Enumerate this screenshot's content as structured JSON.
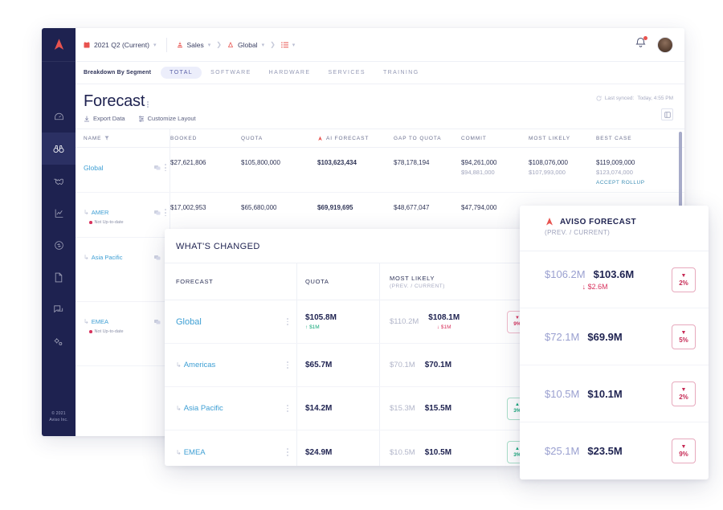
{
  "app": {
    "logo_alt": "aviso-logo",
    "copyright_line1": "© 2021",
    "copyright_line2": "Aviso Inc."
  },
  "sidebar": {
    "items": [
      {
        "name": "dashboard",
        "icon": "gauge-icon"
      },
      {
        "name": "forecast",
        "icon": "binoculars-icon",
        "active": true
      },
      {
        "name": "deals",
        "icon": "handshake-icon"
      },
      {
        "name": "analytics",
        "icon": "chart-icon"
      },
      {
        "name": "activity",
        "icon": "sync-icon"
      },
      {
        "name": "reports",
        "icon": "document-icon"
      },
      {
        "name": "conversations",
        "icon": "chat-icon"
      },
      {
        "name": "settings",
        "icon": "gears-icon"
      }
    ]
  },
  "topbar": {
    "period": "2021 Q2 (Current)",
    "team": "Sales",
    "scope": "Global",
    "notification_badge": true
  },
  "segment_bar": {
    "label": "Breakdown By Segment",
    "tabs": [
      {
        "label": "TOTAL",
        "active": true
      },
      {
        "label": "SOFTWARE",
        "active": false
      },
      {
        "label": "HARDWARE",
        "active": false
      },
      {
        "label": "SERVICES",
        "active": false
      },
      {
        "label": "TRAINING",
        "active": false
      }
    ]
  },
  "page": {
    "title": "Forecast",
    "actions": [
      {
        "label": "Export Data",
        "icon": "download-icon"
      },
      {
        "label": "Customize Layout",
        "icon": "sliders-icon"
      }
    ],
    "sync_label": "Last synced:",
    "sync_value": "Today, 4:55 PM"
  },
  "table": {
    "columns": [
      "NAME",
      "BOOKED",
      "QUOTA",
      "AI FORECAST",
      "GAP TO QUOTA",
      "COMMIT",
      "MOST LIKELY",
      "BEST CASE"
    ],
    "rows": [
      {
        "name": "Global",
        "indent": false,
        "stale": null,
        "booked": "$27,621,806",
        "quota": "$105,800,000",
        "ai_forecast": "$103,623,434",
        "gap_to_quota": "$78,178,194",
        "commit": "$94,261,000",
        "commit_prev": "$94,881,000",
        "most_likely": "$108,076,000",
        "most_likely_prev": "$107,993,000",
        "best_case": "$119,009,000",
        "best_case_prev": "$123,074,000",
        "accept_rollup": "ACCEPT ROLLUP"
      },
      {
        "name": "AMER",
        "indent": true,
        "stale": "Not Up-to-date",
        "booked": "$17,002,953",
        "quota": "$65,680,000",
        "ai_forecast": "$69,919,695",
        "gap_to_quota": "$48,677,047",
        "commit": "$47,794,000",
        "commit_prev": "",
        "most_likely": "",
        "most_likely_prev": "",
        "best_case": "",
        "best_case_prev": "",
        "accept_rollup": ""
      },
      {
        "name": "Asia Pacific",
        "indent": true,
        "stale": null,
        "booked": "",
        "quota": "",
        "ai_forecast": "",
        "gap_to_quota": "",
        "commit": "",
        "commit_prev": "",
        "most_likely": "",
        "most_likely_prev": "",
        "best_case": "",
        "best_case_prev": "",
        "accept_rollup": ""
      },
      {
        "name": "EMEA",
        "indent": true,
        "stale": "Not Up-to-date",
        "booked": "",
        "quota": "",
        "ai_forecast": "",
        "gap_to_quota": "",
        "commit": "",
        "commit_prev": "",
        "most_likely": "",
        "most_likely_prev": "",
        "best_case": "",
        "best_case_prev": "",
        "accept_rollup": ""
      }
    ]
  },
  "whats_changed": {
    "title": "WHAT'S CHANGED",
    "col_forecast": "FORECAST",
    "col_quota": "QUOTA",
    "col_most_likely": "MOST LIKELY",
    "col_most_likely_sub": "(PREV. / CURRENT)",
    "rows": [
      {
        "name": "Global",
        "indent": false,
        "quota": "$105.8M",
        "quota_delta": "$1M",
        "quota_dir": "up",
        "ml_prev": "$110.2M",
        "ml_cur": "$108.1M",
        "ml_delta": "$1M",
        "ml_dir": "down",
        "pct": "9%",
        "pct_dir": "down"
      },
      {
        "name": "Americas",
        "indent": true,
        "quota": "$65.7M",
        "quota_delta": "",
        "quota_dir": "",
        "ml_prev": "$70.1M",
        "ml_cur": "$70.1M",
        "ml_delta": "",
        "ml_dir": "",
        "pct": "",
        "pct_dir": ""
      },
      {
        "name": "Asia Pacific",
        "indent": true,
        "quota": "$14.2M",
        "quota_delta": "",
        "quota_dir": "",
        "ml_prev": "$15.3M",
        "ml_cur": "$15.5M",
        "ml_delta": "",
        "ml_dir": "",
        "pct": "3%",
        "pct_dir": "up"
      },
      {
        "name": "EMEA",
        "indent": true,
        "quota": "$24.9M",
        "quota_delta": "",
        "quota_dir": "",
        "ml_prev": "$10.5M",
        "ml_cur": "$10.5M",
        "ml_delta": "",
        "ml_dir": "",
        "pct": "3%",
        "pct_dir": "up"
      }
    ]
  },
  "aviso_forecast": {
    "title": "AVISO FORECAST",
    "subtitle": "(PREV. / CURRENT)",
    "rows": [
      {
        "prev": "$106.2M",
        "current": "$103.6M",
        "delta": "$2.6M",
        "delta_dir": "down",
        "pct": "2%",
        "pct_dir": "down"
      },
      {
        "prev": "$72.1M",
        "current": "$69.9M",
        "delta": "",
        "delta_dir": "",
        "pct": "5%",
        "pct_dir": "down"
      },
      {
        "prev": "$10.5M",
        "current": "$10.1M",
        "delta": "",
        "delta_dir": "",
        "pct": "2%",
        "pct_dir": "down"
      },
      {
        "prev": "$25.1M",
        "current": "$23.5M",
        "delta": "",
        "delta_dir": "",
        "pct": "9%",
        "pct_dir": "down"
      }
    ]
  },
  "colors": {
    "sidebar": "#1e2250",
    "brand_red": "#e8534f",
    "link_blue": "#3e9fd4",
    "accent_blue": "#2b62e0",
    "up_green": "#15a87a",
    "down_red": "#d8335e",
    "navy": "#1e2250"
  }
}
